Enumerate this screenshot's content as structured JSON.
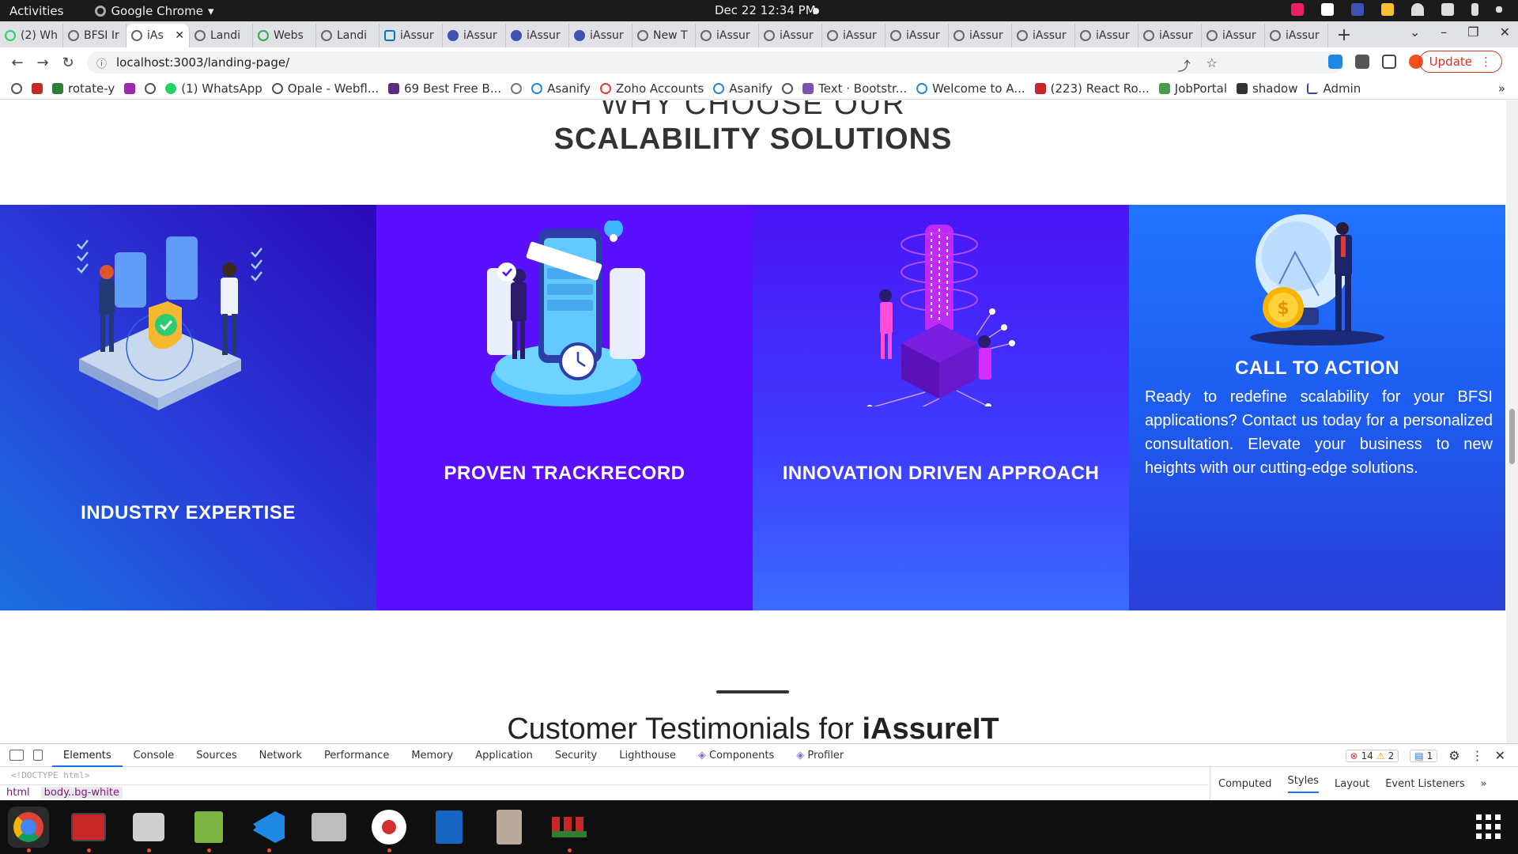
{
  "system": {
    "activities": "Activities",
    "app_menu": "Google Chrome",
    "clock": "Dec 22  12:34 PM"
  },
  "tabs": [
    {
      "label": "(2) Wh"
    },
    {
      "label": "BFSI Ir"
    },
    {
      "label": "iAs",
      "active": true
    },
    {
      "label": "Landi"
    },
    {
      "label": "Webs"
    },
    {
      "label": "Landi"
    },
    {
      "label": "iAssur"
    },
    {
      "label": "iAssur"
    },
    {
      "label": "iAssur"
    },
    {
      "label": "iAssur"
    },
    {
      "label": "New T"
    },
    {
      "label": "iAssur"
    },
    {
      "label": "iAssur"
    },
    {
      "label": "iAssur"
    },
    {
      "label": "iAssur"
    },
    {
      "label": "iAssur"
    },
    {
      "label": "iAssur"
    },
    {
      "label": "iAssur"
    },
    {
      "label": "iAssur"
    },
    {
      "label": "iAssur"
    },
    {
      "label": "iAssur"
    }
  ],
  "omnibox": {
    "url": "localhost:3003/landing-page/",
    "update_label": "Update"
  },
  "bookmarks": [
    {
      "label": "rotate-y",
      "color": "#2e7d32"
    },
    {
      "label": "(1) WhatsApp",
      "color": "#25d366"
    },
    {
      "label": "Opale - Webfl...",
      "color": "#555555"
    },
    {
      "label": "69 Best Free B...",
      "color": "#5a2d82"
    },
    {
      "label": "Asanify",
      "color": "#1e88e5"
    },
    {
      "label": "Zoho Accounts",
      "color": "#e53935"
    },
    {
      "label": "Asanify",
      "color": "#1e88e5"
    },
    {
      "label": "Text · Bootstr...",
      "color": "#7952b3"
    },
    {
      "label": "Welcome to A...",
      "color": "#1e88e5"
    },
    {
      "label": "(223) React Ro...",
      "color": "#c62828"
    },
    {
      "label": "JobPortal",
      "color": "#43a047"
    },
    {
      "label": "shadow",
      "color": "#333333"
    },
    {
      "label": "Admin",
      "color": "#3949ab"
    }
  ],
  "page": {
    "why_choose": "WHY CHOOSE OUR",
    "heading": "SCALABILITY SOLUTIONS",
    "cards": [
      {
        "title": "INDUSTRY EXPERTISE"
      },
      {
        "title": "PROVEN TRACKRECORD"
      },
      {
        "title": "INNOVATION DRIVEN APPROACH"
      },
      {
        "title": "CALL TO ACTION",
        "body": "Ready to redefine scalability for your BFSI applications? Contact us today for a personalized consultation. Elevate your business to new heights with our cutting-edge solutions."
      }
    ],
    "testimonials_prefix": "Customer Testimonials for ",
    "testimonials_brand": "iAssureIT"
  },
  "devtools": {
    "tabs": [
      "Elements",
      "Console",
      "Sources",
      "Network",
      "Performance",
      "Memory",
      "Application",
      "Security",
      "Lighthouse",
      "Components",
      "Profiler"
    ],
    "errors": "14",
    "warnings": "2",
    "messages": "1",
    "doctype": "<!DOCTYPE html>",
    "crumb_html": "html",
    "crumb_body": "body..bg-white",
    "style_tabs": [
      "Computed",
      "Styles",
      "Layout",
      "Event Listeners"
    ]
  },
  "dock": [
    {
      "name": "chrome",
      "color": "#4285f4"
    },
    {
      "name": "app-red",
      "color": "#c62828"
    },
    {
      "name": "files",
      "color": "#cfcfcf"
    },
    {
      "name": "text-editor",
      "color": "#7cb342"
    },
    {
      "name": "vscode",
      "color": "#1e88e5"
    },
    {
      "name": "search-tool",
      "color": "#9e9e9e"
    },
    {
      "name": "recorder",
      "color": "#e53935"
    },
    {
      "name": "document",
      "color": "#1565c0"
    },
    {
      "name": "archive",
      "color": "#a1887f"
    },
    {
      "name": "grid-app",
      "color": "#2e7d32"
    }
  ]
}
